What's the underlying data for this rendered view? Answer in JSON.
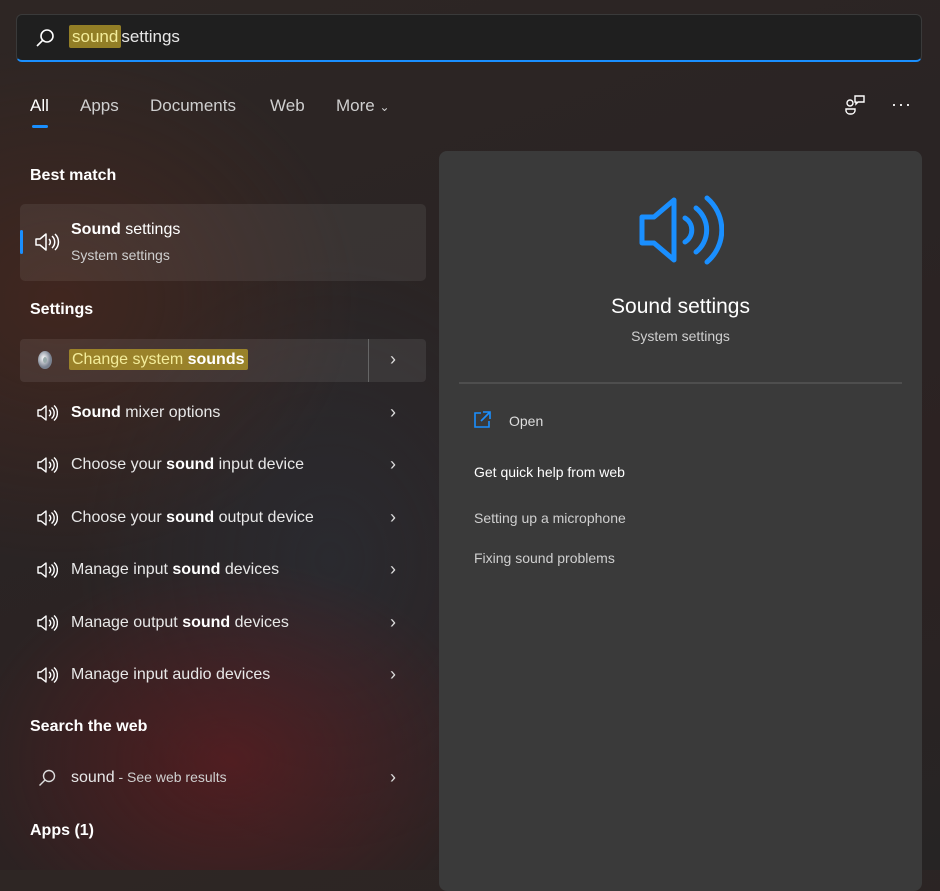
{
  "search": {
    "query_highlight": "sound",
    "query_rest": "settings"
  },
  "tabs": [
    {
      "label": "All"
    },
    {
      "label": "Apps"
    },
    {
      "label": "Documents"
    },
    {
      "label": "Web"
    },
    {
      "label": "More"
    }
  ],
  "best_match": {
    "header": "Best match",
    "title_bold": "Sound",
    "title_rest": " settings",
    "subtitle": "System settings"
  },
  "settings": {
    "header": "Settings",
    "items": [
      {
        "pre": "Change system ",
        "bold": "sounds",
        "post": ""
      },
      {
        "pre": "",
        "bold": "Sound",
        "post": " mixer options"
      },
      {
        "pre": "Choose your ",
        "bold": "sound",
        "post": " input device"
      },
      {
        "pre": "Choose your ",
        "bold": "sound",
        "post": " output device"
      },
      {
        "pre": "Manage input ",
        "bold": "sound",
        "post": " devices"
      },
      {
        "pre": "Manage output ",
        "bold": "sound",
        "post": " devices"
      },
      {
        "pre": "Manage input audio devices",
        "bold": "",
        "post": ""
      }
    ]
  },
  "web": {
    "header": "Search the web",
    "query": "sound",
    "suffix": " - See web results"
  },
  "apps": {
    "header": "Apps (1)"
  },
  "preview": {
    "title": "Sound settings",
    "subtitle": "System settings",
    "open_label": "Open",
    "help_header": "Get quick help from web",
    "links": [
      "Setting up a microphone",
      "Fixing sound problems"
    ]
  },
  "colors": {
    "accent": "#1a8fff",
    "highlight": "#af9628"
  }
}
